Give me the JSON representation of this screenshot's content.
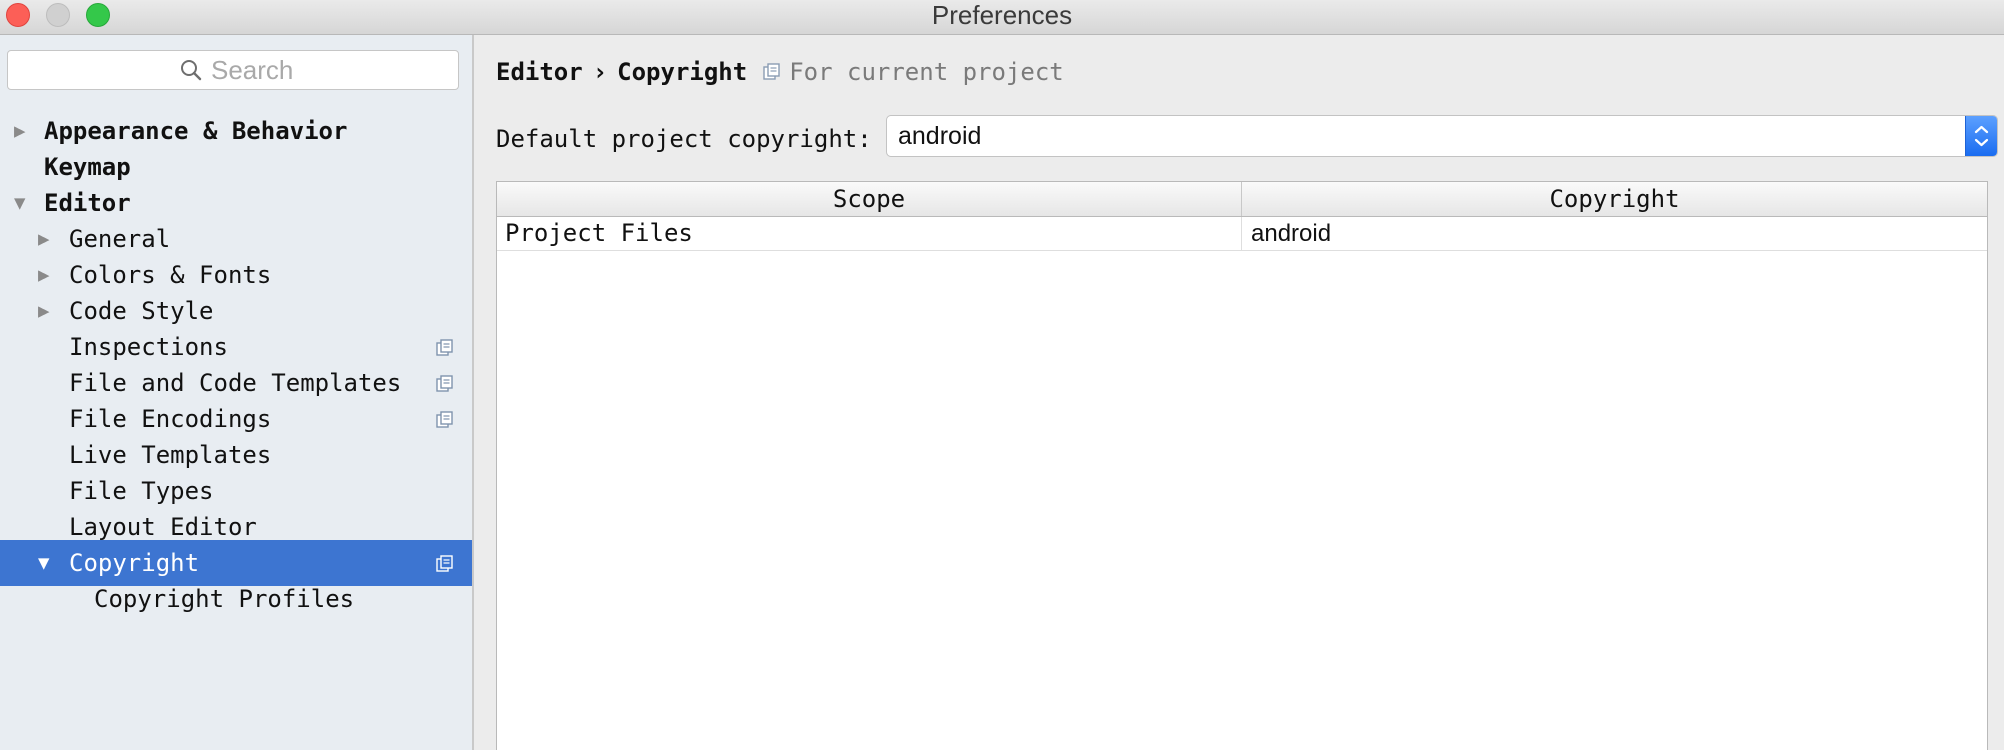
{
  "window": {
    "title": "Preferences"
  },
  "sidebar": {
    "search": {
      "placeholder": "Search",
      "value": ""
    },
    "items": [
      {
        "label": "Appearance & Behavior",
        "level": 0,
        "expander": "collapsed",
        "bold": true,
        "has_project_icon": false,
        "selected": false
      },
      {
        "label": "Keymap",
        "level": 0,
        "expander": "none",
        "bold": true,
        "has_project_icon": false,
        "selected": false
      },
      {
        "label": "Editor",
        "level": 0,
        "expander": "expanded",
        "bold": true,
        "has_project_icon": false,
        "selected": false
      },
      {
        "label": "General",
        "level": 1,
        "expander": "collapsed",
        "bold": false,
        "has_project_icon": false,
        "selected": false
      },
      {
        "label": "Colors & Fonts",
        "level": 1,
        "expander": "collapsed",
        "bold": false,
        "has_project_icon": false,
        "selected": false
      },
      {
        "label": "Code Style",
        "level": 1,
        "expander": "collapsed",
        "bold": false,
        "has_project_icon": false,
        "selected": false
      },
      {
        "label": "Inspections",
        "level": 1,
        "expander": "none",
        "bold": false,
        "has_project_icon": true,
        "selected": false
      },
      {
        "label": "File and Code Templates",
        "level": 1,
        "expander": "none",
        "bold": false,
        "has_project_icon": true,
        "selected": false
      },
      {
        "label": "File Encodings",
        "level": 1,
        "expander": "none",
        "bold": false,
        "has_project_icon": true,
        "selected": false
      },
      {
        "label": "Live Templates",
        "level": 1,
        "expander": "none",
        "bold": false,
        "has_project_icon": false,
        "selected": false
      },
      {
        "label": "File Types",
        "level": 1,
        "expander": "none",
        "bold": false,
        "has_project_icon": false,
        "selected": false
      },
      {
        "label": "Layout Editor",
        "level": 1,
        "expander": "none",
        "bold": false,
        "has_project_icon": false,
        "selected": false
      },
      {
        "label": "Copyright",
        "level": 1,
        "expander": "expanded",
        "bold": false,
        "has_project_icon": true,
        "selected": true
      },
      {
        "label": "Copyright Profiles",
        "level": 2,
        "expander": "none",
        "bold": false,
        "has_project_icon": false,
        "selected": false
      }
    ]
  },
  "main": {
    "breadcrumb": {
      "items": [
        "Editor",
        "Copyright"
      ],
      "separator": "›",
      "scope_note": "For current project"
    },
    "default_copyright": {
      "label": "Default project copyright:",
      "value": "android"
    },
    "table": {
      "columns": [
        "Scope",
        "Copyright"
      ],
      "rows": [
        {
          "scope": "Project Files",
          "copyright": "android"
        }
      ]
    }
  },
  "colors": {
    "selection": "#3d75d1",
    "sidebar_bg": "#e8edf2",
    "window_bg": "#ececec",
    "close_button": "#fc5f57",
    "zoom_button": "#34c84a",
    "stepper_blue": "#2f7df6"
  },
  "icons": {
    "search": "search-icon",
    "project_scope": "copy-icon",
    "collapsed": "triangle-right-icon",
    "expanded": "triangle-down-icon",
    "select_stepper": "chevron-up-down-icon"
  }
}
